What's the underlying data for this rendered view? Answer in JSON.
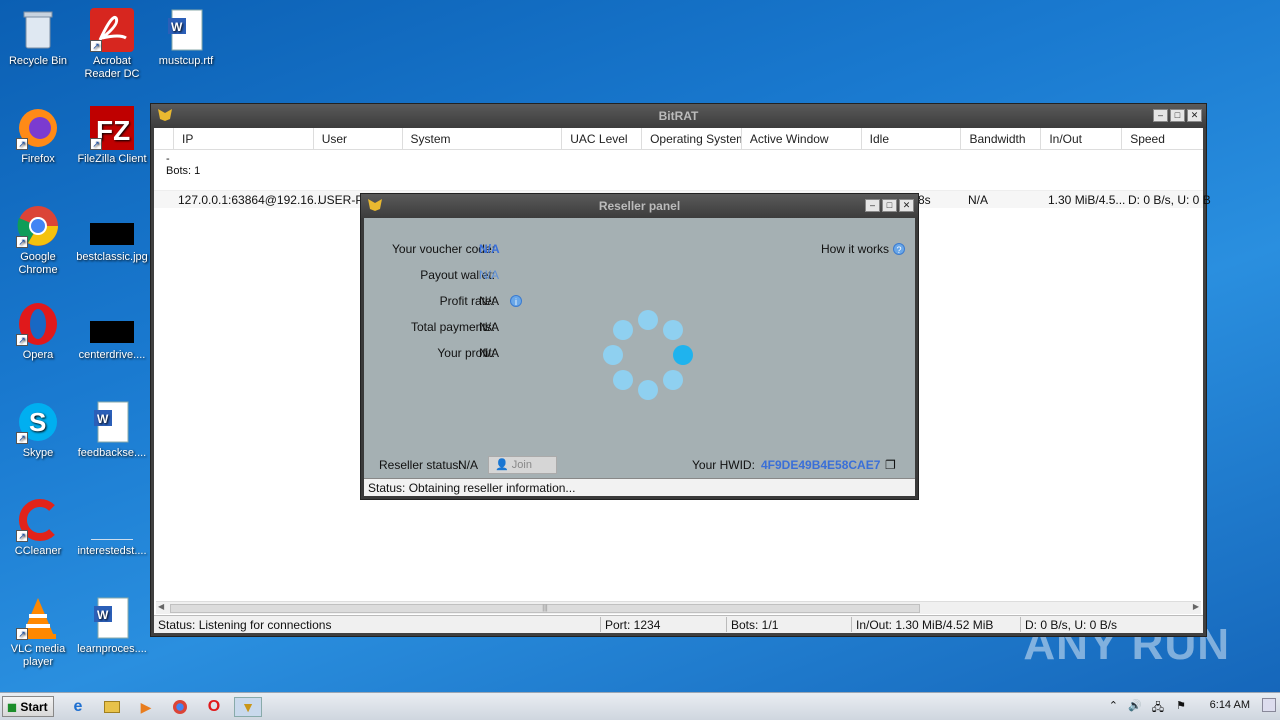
{
  "desktop": {
    "icons": [
      {
        "label": "Recycle Bin",
        "icon": "recycle-bin-icon"
      },
      {
        "label": "Acrobat Reader DC",
        "icon": "acrobat-icon"
      },
      {
        "label": "mustcup.rtf",
        "icon": "word-doc-icon"
      },
      {
        "label": "Firefox",
        "icon": "firefox-icon"
      },
      {
        "label": "FileZilla Client",
        "icon": "filezilla-icon"
      },
      {
        "label": "Google Chrome",
        "icon": "chrome-icon"
      },
      {
        "label": "bestclassic.jpg",
        "icon": "image-file-icon"
      },
      {
        "label": "Opera",
        "icon": "opera-icon"
      },
      {
        "label": "centerdrive....",
        "icon": "image-file-icon"
      },
      {
        "label": "Skype",
        "icon": "skype-icon"
      },
      {
        "label": "feedbackse....",
        "icon": "word-doc-icon"
      },
      {
        "label": "CCleaner",
        "icon": "ccleaner-icon"
      },
      {
        "label": "interestedst....",
        "icon": "blank-file-icon"
      },
      {
        "label": "VLC media player",
        "icon": "vlc-icon"
      },
      {
        "label": "learnproces....",
        "icon": "word-doc-icon"
      }
    ]
  },
  "main_window": {
    "title": "BitRAT",
    "columns": [
      "IP",
      "User",
      "System",
      "UAC Level",
      "Operating System",
      "Active Window",
      "Idle",
      "Bandwidth",
      "In/Out",
      "Speed"
    ],
    "group_dash": "-",
    "group_label": "Bots: 1",
    "row": {
      "ip": "127.0.0.1:63864@192.16...",
      "user": "USER-PC",
      "idle": "8s",
      "bandwidth": "N/A",
      "inout": "1.30 MiB/4.5...",
      "speed": "D: 0 B/s, U: 0 B"
    },
    "status": {
      "text": "Status: Listening for connections",
      "port": "Port: 1234",
      "bots": "Bots: 1/1",
      "inout": "In/Out: 1.30 MiB/4.52 MiB",
      "speed": "D: 0 B/s, U: 0 B/s"
    }
  },
  "reseller": {
    "title": "Reseller panel",
    "voucher_label": "Your voucher code:",
    "voucher_value": "N/A",
    "wallet_label": "Payout wallet:",
    "wallet_value": "N/A",
    "profit_rate_label": "Profit rate:",
    "profit_rate_value": "N/A",
    "total_label": "Total payments:",
    "total_value": "N/A",
    "profit_label": "Your profit:",
    "profit_value": "N/A",
    "how_it_works": "How it works",
    "status_label": "Reseller status:",
    "status_value": "N/A",
    "join_label": "Join",
    "hwid_label": "Your HWID:",
    "hwid_value": "4F9DE49B4E58CAE7",
    "status_text": "Status: Obtaining reseller information..."
  },
  "taskbar": {
    "start_label": "Start",
    "clock": "6:14 AM"
  },
  "watermark": "ANY RUN"
}
